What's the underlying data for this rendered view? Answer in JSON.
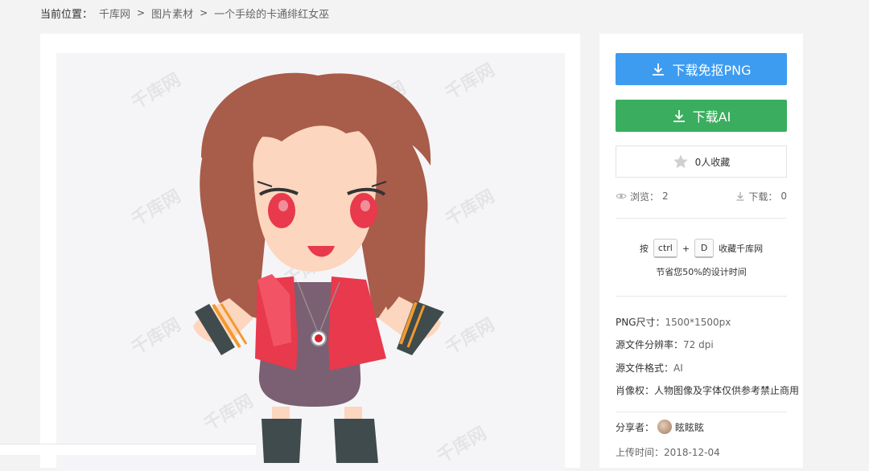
{
  "breadcrumb": {
    "label": "当前位置：",
    "items": [
      "千库网",
      "图片素材",
      "一个手绘的卡通绯红女巫"
    ],
    "separator": ">"
  },
  "preview": {
    "watermark_text": "千库网"
  },
  "actions": {
    "download_png": "下载免抠PNG",
    "download_ai": "下载AI",
    "favorite": "0人收藏"
  },
  "stats": {
    "views_label": "浏览：",
    "views": "2",
    "downloads_label": "下载：",
    "downloads": "0"
  },
  "shortcut": {
    "press": "按",
    "key1": "ctrl",
    "plus": "+",
    "key2": "D",
    "action": "收藏千库网",
    "tip": "节省您50%的设计时间"
  },
  "info": {
    "png_size_label": "PNG尺寸：",
    "png_size": "1500*1500px",
    "resolution_label": "源文件分辨率：",
    "resolution": "72 dpi",
    "format_label": "源文件格式：",
    "format": "AI",
    "rights_label": "肖像权：",
    "rights": "人物图像及字体仅供参考禁止商用"
  },
  "sharer": {
    "label": "分享者：",
    "name": "眩眩眩"
  },
  "upload": {
    "label": "上传时间：",
    "date": "2018-12-04"
  },
  "colors": {
    "png_button": "#3d9cf0",
    "ai_button": "#3aae5e",
    "hair": "#a85c4a",
    "jacket": "#e8394d",
    "dress": "#7a6072",
    "skin": "#fcd6be"
  },
  "icons": [
    "download-icon",
    "star-icon",
    "eye-icon"
  ]
}
